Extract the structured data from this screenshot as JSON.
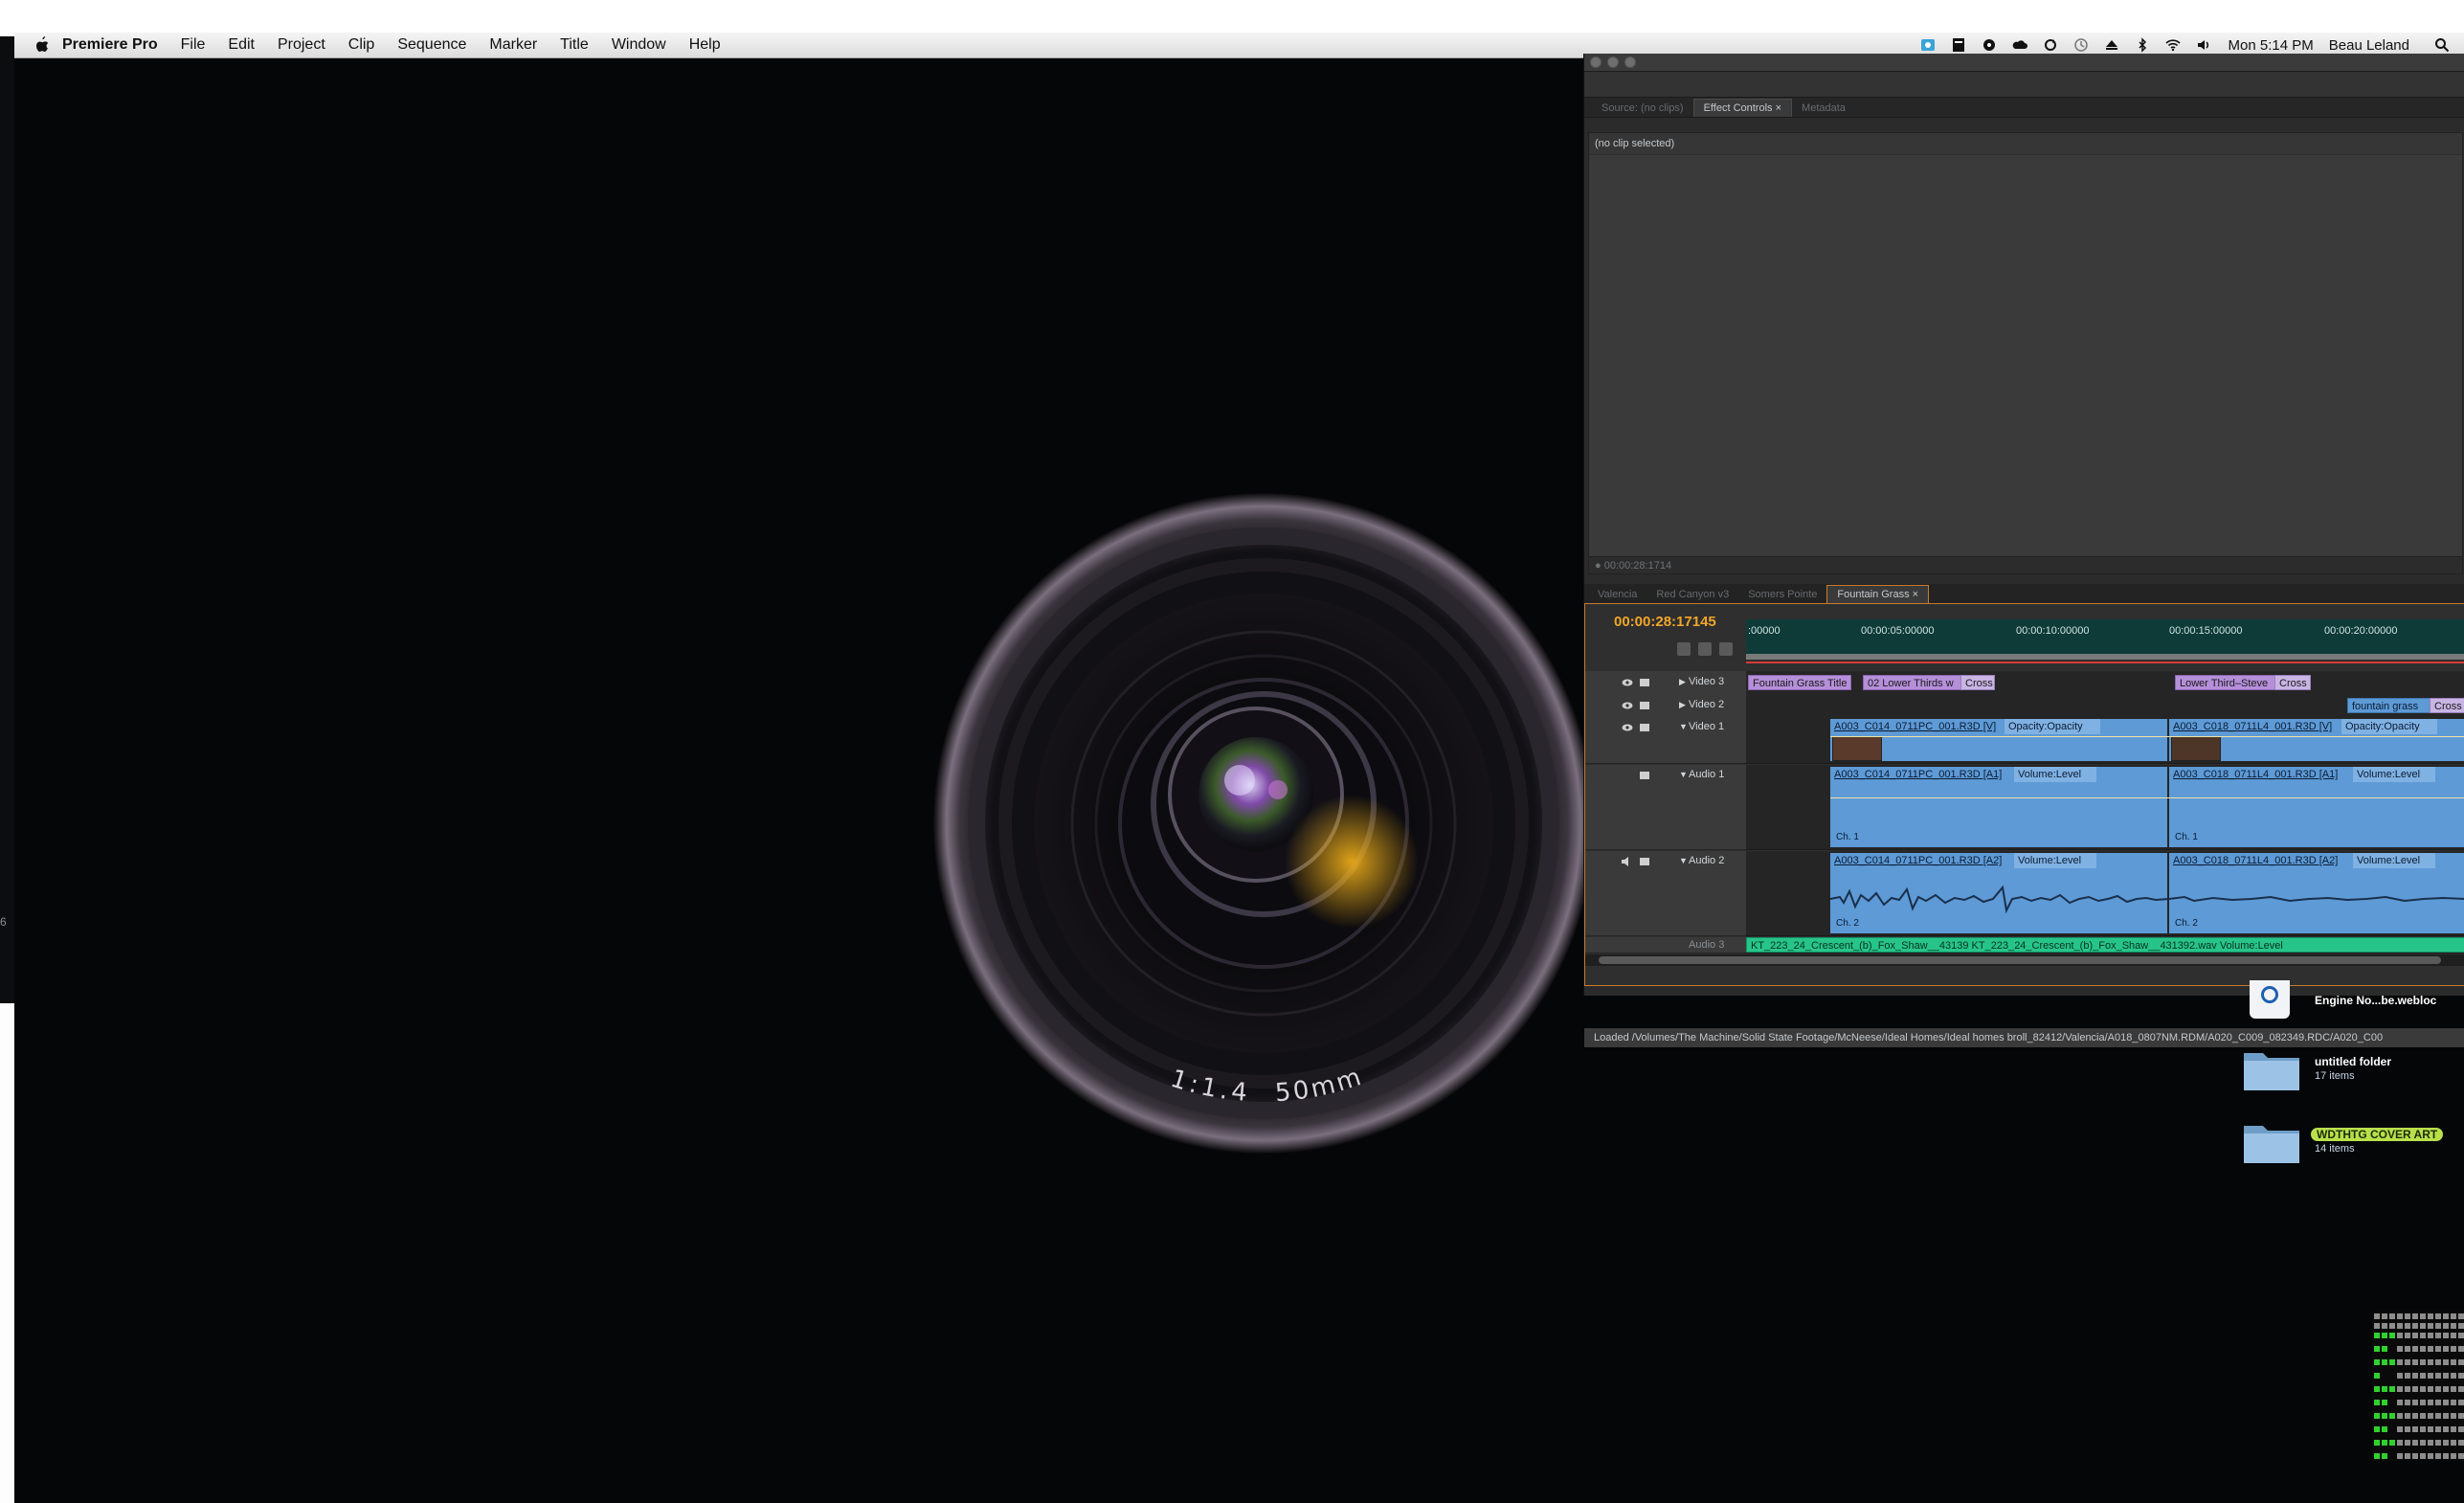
{
  "menubar": {
    "app_name": "Premiere Pro",
    "items": [
      "File",
      "Edit",
      "Project",
      "Clip",
      "Sequence",
      "Marker",
      "Title",
      "Window",
      "Help"
    ],
    "clock": "Mon 5:14 PM",
    "user": "Beau Leland",
    "status_icons": [
      "finder-status-icon",
      "document-icon",
      "gamepad-icon",
      "cloud-icon",
      "sync-icon",
      "time-machine-icon",
      "eject-icon",
      "bluetooth-icon",
      "wifi-icon",
      "volume-icon"
    ]
  },
  "left_edge": {
    "marker_text": "6"
  },
  "lens": {
    "engraving_1": "50mm",
    "engraving_2": "1:1.4"
  },
  "premiere": {
    "source_tabs": [
      {
        "label": "Source: (no clips)",
        "active": false
      },
      {
        "label": "Effect Controls",
        "active": true,
        "close": "×"
      },
      {
        "label": "Metadata",
        "active": false
      }
    ],
    "effect_controls": {
      "no_clip": "(no clip selected)",
      "footer_time": "00:00:28:1714"
    },
    "sequence_tabs": [
      {
        "label": "Valencia",
        "active": false
      },
      {
        "label": "Red Canyon v3",
        "active": false
      },
      {
        "label": "Somers Pointe",
        "active": false
      },
      {
        "label": "Fountain Grass",
        "active": true,
        "close": "×"
      }
    ],
    "timeline": {
      "timecode": "00:00:28:17145",
      "ruler": [
        ":00000",
        "00:00:05:00000",
        "00:00:10:00000",
        "00:00:15:00000",
        "00:00:20:00000"
      ],
      "tracks": {
        "video3": "Video 3",
        "video2": "Video 2",
        "video1": "Video 1",
        "audio1": "Audio 1",
        "audio2": "Audio 2",
        "audio3": "Audio 3"
      },
      "clips": {
        "v3_a": "Fountain Grass Title",
        "v3_b": "02 Lower Thirds w",
        "v3_c": "Cross",
        "v3_d": "Lower Third–Steve",
        "v3_e": "Cross",
        "v2_a": "fountain grass",
        "v2_b": "Cross",
        "v1_a": "A003_C014_0711PC_001.R3D [V]",
        "v1_a_fx": "Opacity:Opacity",
        "v1_b": "A003_C018_0711L4_001.R3D [V]",
        "v1_b_fx": "Opacity:Opacity",
        "a1_a": "A003_C014_0711PC_001.R3D [A1]",
        "a1_a_fx": "Volume:Level",
        "a1_b": "A003_C018_0711L4_001.R3D [A1]",
        "a1_b_fx": "Volume:Level",
        "a1_ch": "Ch. 1",
        "a2_a": "A003_C014_0711PC_001.R3D [A2]",
        "a2_a_fx": "Volume:Level",
        "a2_b": "A003_C018_0711L4_001.R3D [A2]",
        "a2_b_fx": "Volume:Level",
        "a2_ch": "Ch. 2",
        "a3": "KT_223_24_Crescent_(b)_Fox_Shaw__43139 KT_223_24_Crescent_(b)_Fox_Shaw__431392.wav Volume:Level"
      }
    },
    "status": "Loaded /Volumes/The Machine/Solid State Footage/McNeese/Ideal Homes/Ideal homes broll_82412/Valencia/A018_0807NM.RDM/A020_C009_082349.RDC/A020_C00"
  },
  "desktop": [
    {
      "label": "Engine No...be.webloc",
      "sub": ""
    },
    {
      "label": "untitled folder",
      "sub": "17 items"
    },
    {
      "label": "WDTHTG COVER ART",
      "sub": "14 items"
    }
  ]
}
